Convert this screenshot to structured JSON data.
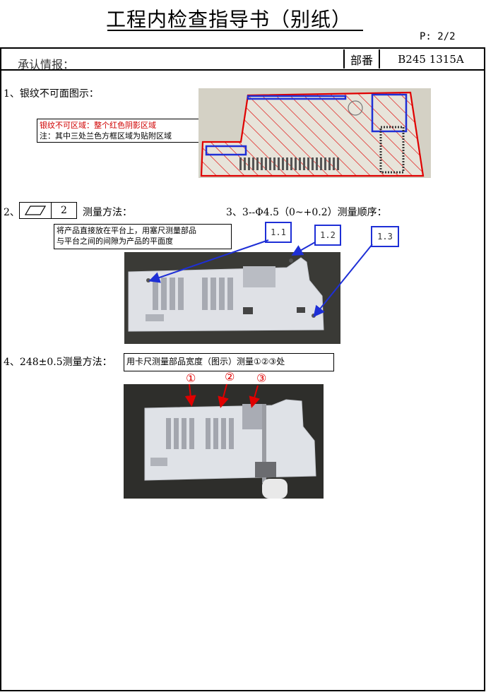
{
  "header": {
    "title": "工程内检查指导书（别纸）",
    "page": "P: 2/2",
    "approval_label": "承认情报：",
    "dept_label": "部番",
    "part_number": "B245 1315A"
  },
  "section1": {
    "heading": "1、银纹不可面图示：",
    "note_red": "银纹不可区域：整个红色阴影区域",
    "note_black": "注：其中三处兰色方框区域为贴附区域"
  },
  "section2": {
    "prefix": "2、",
    "flatness_value": "2",
    "method_label": "测量方法：",
    "note_line1": "将产品直接放在平台上，用塞尺测量部品",
    "note_line2": "与平台之间的间隙为产品的平面度"
  },
  "section3": {
    "heading": "3、3--Φ4.5（0~+0.2）测量顺序：",
    "labels": [
      "1.1",
      "1.2",
      "1.3"
    ]
  },
  "section4": {
    "heading": "4、248±0.5测量方法：",
    "note": "用卡尺测量部品宽度（图示）测量①②③处",
    "markers": [
      "①",
      "②",
      "③"
    ]
  },
  "colors": {
    "hatch_red": "#e00000",
    "zone_blue": "#1e2fd6",
    "arrow_blue": "#1e2fd6"
  },
  "icons": {
    "flatness_symbol": "parallelogram-icon"
  }
}
